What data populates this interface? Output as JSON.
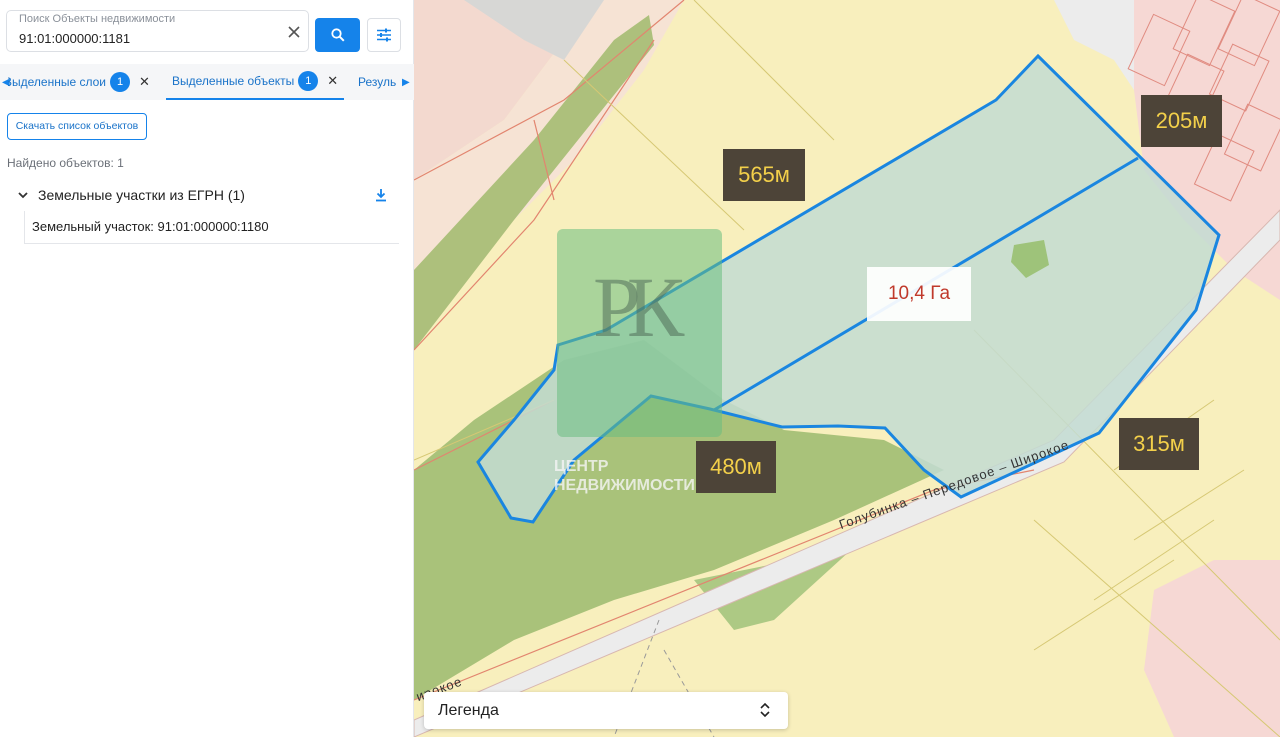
{
  "search": {
    "label": "Поиск Объекты недвижимости",
    "value": "91:01:000000:1181"
  },
  "tabs": [
    {
      "label": "Выделенные слои",
      "badge": "1"
    },
    {
      "label": "Выделенные объекты",
      "badge": "1",
      "active": true
    },
    {
      "label": "Резуль"
    }
  ],
  "actions": {
    "download_list": "Скачать список объектов"
  },
  "results": {
    "found": "Найдено объектов: 1",
    "group": "Земельные участки из ЕГРН (1)",
    "item": "Земельный участок: 91:01:000000:1180"
  },
  "map": {
    "distances": {
      "top": "565м",
      "right_top": "205м",
      "bottom": "480м",
      "right_bottom": "315м"
    },
    "area": "10,4 Га",
    "road": "Голубинка – Передовое – Широкое",
    "road_fragment": "ирокое",
    "watermark": {
      "logo": "РК",
      "line1": "ЦЕНТР",
      "line2": "НЕДВИЖИМОСТИ"
    },
    "legend": "Легенда"
  },
  "colors": {
    "accent": "#1583ea",
    "parcel_outline": "#1a86e0",
    "label_bg": "#4d4438",
    "label_text": "#f3d04a",
    "area_text": "#c0392b"
  },
  "icons": [
    "clear-icon",
    "search-icon",
    "filter-icon",
    "chevron-left-icon",
    "chevron-right-icon",
    "close-icon",
    "chevron-down-icon",
    "download-icon",
    "updown-icon"
  ]
}
